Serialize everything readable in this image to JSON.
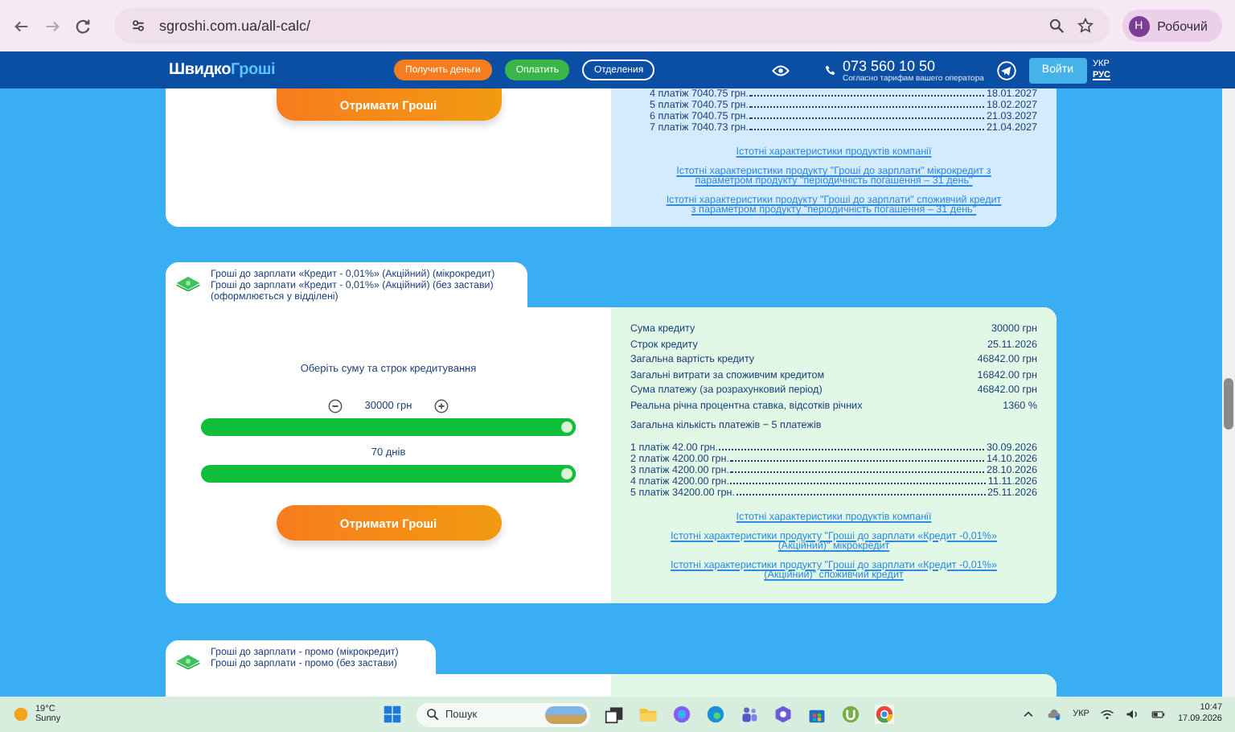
{
  "browser": {
    "url": "sgroshi.com.ua/all-calc/",
    "profile_initial": "Н",
    "profile_name": "Робочий"
  },
  "header": {
    "logo": {
      "first": "Швидко",
      "second": "Гроші"
    },
    "nav": [
      {
        "label": "Получить деньги",
        "kind": "orange"
      },
      {
        "label": "Оплатить",
        "kind": "green"
      },
      {
        "label": "Отделения",
        "kind": "outline"
      }
    ],
    "phone": "073 560 10 50",
    "phone_note": "Согласно тарифам вашего оператора",
    "login": "Войти",
    "languages": [
      {
        "label": "УКР",
        "selected": false
      },
      {
        "label": "РУС",
        "selected": true
      }
    ]
  },
  "cards": [
    {
      "color": "#d4ebfd",
      "button": "Отримати Гроші",
      "payments": [
        {
          "label": "4 платіж 7040.75 грн.",
          "date": "18.01.2027"
        },
        {
          "label": "5 платіж 7040.75 грн.",
          "date": "18.02.2027"
        },
        {
          "label": "6 платіж 7040.75 грн.",
          "date": "21.03.2027"
        },
        {
          "label": "7 платіж 7040.73 грн.",
          "date": "21.04.2027"
        }
      ],
      "links": [
        "Істотні характеристики продуктів компанії",
        "Істотні характеристики продукту \"Гроші до зарплати\" мікрокредит з параметром продукту \"періодичність погашення – 31 день\"",
        "Істотні характеристики продукту \"Гроші до зарплати\" споживчий кредит з параметром продукту \"періодичність погашення – 31 день\""
      ]
    },
    {
      "color": "#e0f8e5",
      "tab_lines": [
        "Гроші до зарплати «Кредит - 0,01%» (Акційний) (мікрокредит)",
        "Гроші до зарплати «Кредит - 0,01%» (Акційний) (без застави) (оформлюється у відділені)"
      ],
      "prompt": "Оберіть суму та строк кредитування",
      "sliders": [
        {
          "value": "30000 грн",
          "stepper": true,
          "level": 1
        },
        {
          "value": "70 днів",
          "stepper": false,
          "level": 1
        }
      ],
      "button": "Отримати Гроші",
      "summary": [
        {
          "label": "Сума кредиту",
          "value": "30000 грн"
        },
        {
          "label": "Строк кредиту",
          "value": "25.11.2026"
        },
        {
          "label": "Загальна вартість кредиту",
          "value": "46842.00 грн"
        },
        {
          "label": "Загальні витрати за споживчим кредитом",
          "value": "16842.00 грн"
        },
        {
          "label": "Сума платежу (за розрахунковий період)",
          "value": "46842.00 грн"
        },
        {
          "label": "Реальна річна процентна ставка, відсотків річних",
          "value": "1360 %"
        }
      ],
      "total_payments": "Загальна кількість платежів − 5 платежів",
      "payments": [
        {
          "label": "1 платіж 42.00 грн.",
          "date": "30.09.2026"
        },
        {
          "label": "2 платіж 4200.00 грн.",
          "date": "14.10.2026"
        },
        {
          "label": "3 платіж 4200.00 грн.",
          "date": "28.10.2026"
        },
        {
          "label": "4 платіж 4200.00 грн.",
          "date": "11.11.2026"
        },
        {
          "label": "5 платіж 34200.00 грн.",
          "date": "25.11.2026"
        }
      ],
      "links": [
        "Істотні характеристики продуктів компанії",
        "Істотні характеристики продукту \"Гроші до зарплати «Кредит -0,01%» (Акційний)\" мікрокредит",
        "Істотні характеристики продукту \"Гроші до зарплати «Кредит -0,01%» (Акційний)\" споживчий кредит"
      ]
    },
    {
      "color": "#e0f8e5",
      "tab_lines": [
        "Гроші до зарплати - промо (мікрокредит)",
        "Гроші до зарплати - промо (без застави)"
      ]
    }
  ],
  "taskbar": {
    "weather": {
      "temp": "19°C",
      "condition": "Sunny"
    },
    "search_placeholder": "Пошук",
    "language": "УКР",
    "time": "10:47",
    "date": "17.09.2026"
  }
}
